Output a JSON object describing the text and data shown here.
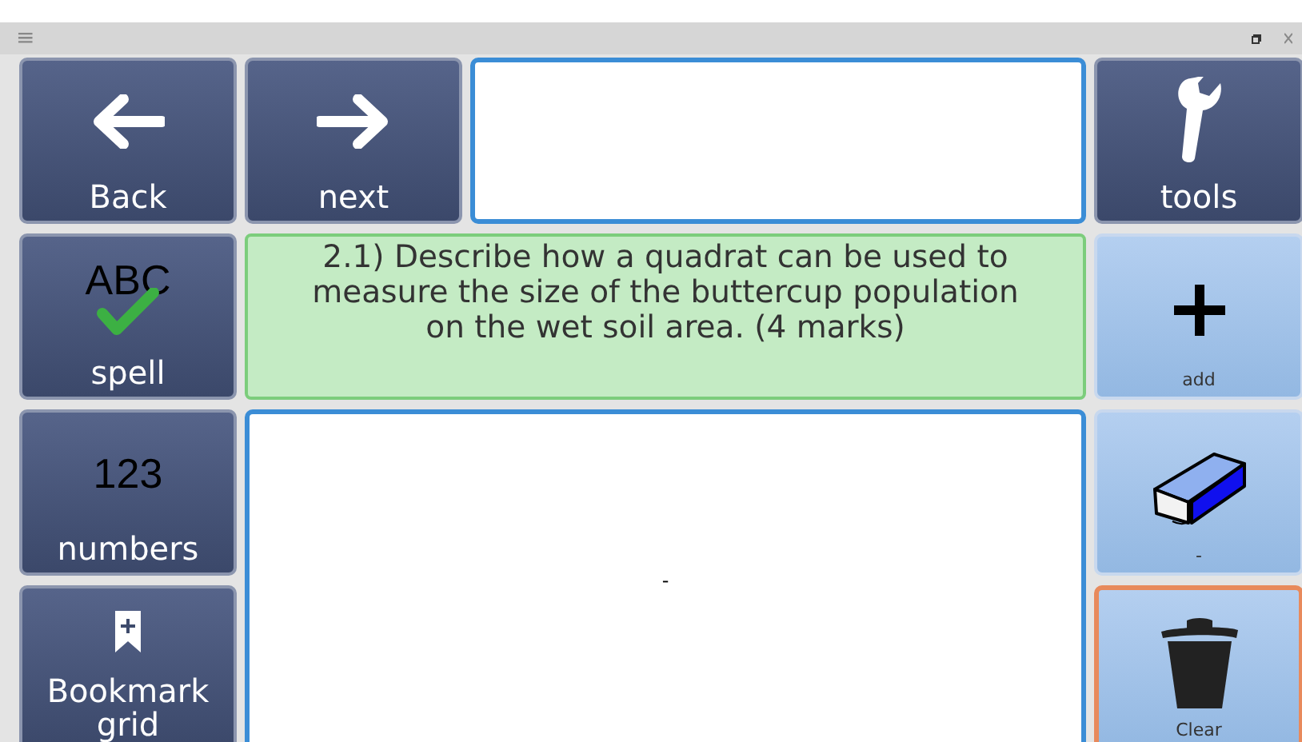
{
  "title_bar": {
    "menu": "≡"
  },
  "left_buttons": [
    {
      "label": "Back",
      "kind": "back"
    },
    {
      "label": "spell",
      "kind": "spell",
      "glyph": "ABC"
    },
    {
      "label": "numbers",
      "kind": "numbers",
      "glyph": "123"
    },
    {
      "label": "Bookmark grid",
      "kind": "bookmark"
    }
  ],
  "next_button": {
    "label": "next",
    "kind": "next"
  },
  "question": {
    "text": "2.1) Describe how a quadrat can be used to measure the size of the buttercup population on the wet soil area. (4 marks)"
  },
  "text_area": {
    "value": "-"
  },
  "right_buttons": [
    {
      "label": "tools",
      "kind": "tools",
      "selected": false
    },
    {
      "label": "add",
      "kind": "add",
      "selected": false
    },
    {
      "label": "-",
      "kind": "erase",
      "selected": false
    },
    {
      "label": "Clear",
      "kind": "clear",
      "selected": true
    }
  ]
}
